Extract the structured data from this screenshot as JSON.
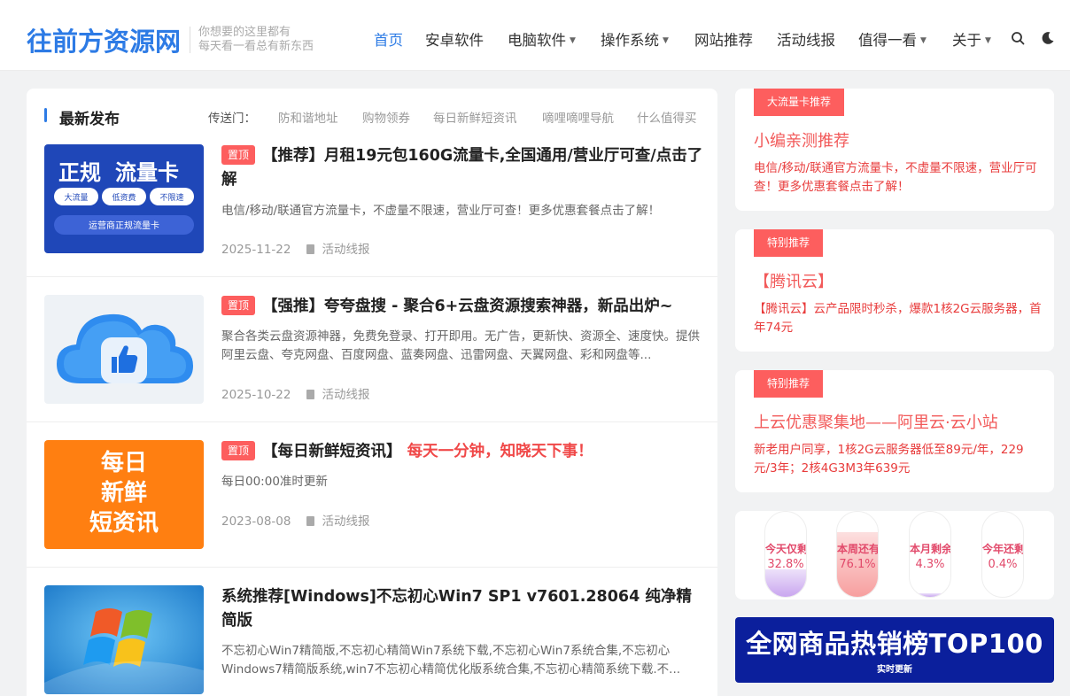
{
  "header": {
    "logo": "往前方资源网",
    "tagline_line1": "你想要的这里都有",
    "tagline_line2": "每天看一看总有新东西",
    "nav": [
      {
        "label": "首页"
      },
      {
        "label": "安卓软件"
      },
      {
        "label": "电脑软件"
      },
      {
        "label": "操作系统"
      },
      {
        "label": "网站推荐"
      },
      {
        "label": "活动线报"
      },
      {
        "label": "值得一看"
      },
      {
        "label": "关于"
      }
    ]
  },
  "section": {
    "title": "最新发布",
    "portal_label": "传送门：",
    "portal_links": [
      "防和谐地址",
      "购物领券",
      "每日新鲜短资讯",
      "嘀哩嘀哩导航",
      "什么值得买"
    ]
  },
  "posts": [
    {
      "badge": "置顶",
      "title": "【推荐】月租19元包160G流量卡,全国通用/营业厅可查/点击了解",
      "excerpt": "电信/移动/联通官方流量卡，不虚量不限速，营业厅可查！更多优惠套餐点击了解！",
      "date": "2025-11-22",
      "category": "活动线报",
      "thumb": {
        "headline_a": "正规",
        "headline_b": "流量卡",
        "tags": [
          "大流量",
          "低资费",
          "不限速"
        ],
        "footer": "运营商正规流量卡"
      }
    },
    {
      "badge": "置顶",
      "title": "【强推】夸夸盘搜 - 聚合6+云盘资源搜索神器，新品出炉~",
      "excerpt": "聚合各类云盘资源神器，免费免登录、打开即用。无广告，更新快、资源全、速度快。提供阿里云盘、夸克网盘、百度网盘、蓝奏网盘、迅雷网盘、天翼网盘、彩和网盘等...",
      "date": "2025-10-22",
      "category": "活动线报"
    },
    {
      "badge": "置顶",
      "title_main": "【每日新鲜短资讯】",
      "title_highlight": "每天一分钟，知晓天下事！",
      "excerpt": "每日00:00准时更新",
      "date": "2023-08-08",
      "category": "活动线报",
      "thumb": {
        "lines": [
          "每日",
          "新鲜",
          "短资讯"
        ]
      }
    },
    {
      "title": "系统推荐[Windows]不忘初心Win7 SP1 v7601.28064 纯净精简版",
      "excerpt": "不忘初心Win7精简版,不忘初心精简Win7系统下载,不忘初心Win7系统合集,不忘初心Windows7精简版系统,win7不忘初心精简优化版系统合集,不忘初心精简系统下载.不..."
    }
  ],
  "sidebar": {
    "widgets": [
      {
        "badge": "大流量卡推荐",
        "title": "小编亲测推荐",
        "desc": "电信/移动/联通官方流量卡，不虚量不限速，营业厅可查！更多优惠套餐点击了解！"
      },
      {
        "badge": "特别推荐",
        "title": "【腾讯云】",
        "desc": "【腾讯云】云产品限时秒杀，爆款1核2G云服务器，首年74元"
      },
      {
        "badge": "特别推荐",
        "title": "上云优惠聚集地——阿里云·云小站",
        "desc": "新老用户同享，1核2G云服务器低至89元/年，229元/3年；2核4G3M3年639元"
      }
    ],
    "time_progress": [
      {
        "label": "今天仅剩",
        "value": "32.8%",
        "fill": 0.328,
        "color": "#c9a6ef"
      },
      {
        "label": "本周还有",
        "value": "76.1%",
        "fill": 0.761,
        "color": "#f79f9f"
      },
      {
        "label": "本月剩余",
        "value": "4.3%",
        "fill": 0.043,
        "color": "#c9a6ef"
      },
      {
        "label": "今年还剩",
        "value": "0.4%",
        "fill": 0.004,
        "color": "#c9a6ef"
      }
    ],
    "banner": {
      "title": "全网商品热销榜TOP100",
      "subtitle": "实时更新"
    }
  },
  "colors": {
    "accent": "#2d7be5",
    "badge": "#fd5e5e",
    "highlight": "#f04848"
  }
}
